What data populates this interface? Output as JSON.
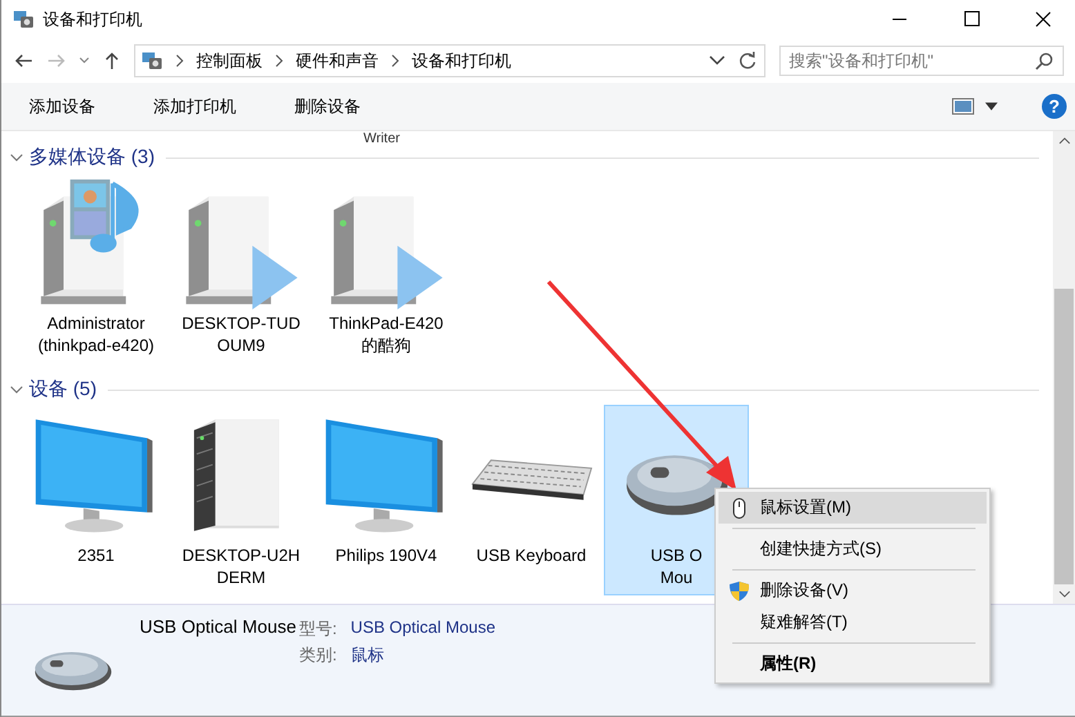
{
  "window": {
    "title": "设备和打印机"
  },
  "address": {
    "crumbs": [
      "控制面板",
      "硬件和声音",
      "设备和打印机"
    ]
  },
  "search": {
    "placeholder": "搜索\"设备和打印机\""
  },
  "toolbar": {
    "buttons": [
      "添加设备",
      "添加打印机",
      "删除设备"
    ],
    "help": "?"
  },
  "partial_label": "Writer",
  "groups": [
    {
      "title": "多媒体设备 (3)",
      "expanded": true,
      "items": [
        {
          "kind": "media-server",
          "lines": [
            "Administrator",
            "(thinkpad-e420)"
          ],
          "selected": false
        },
        {
          "kind": "stream-server",
          "lines": [
            "DESKTOP-TUD",
            "OUM9"
          ],
          "selected": false
        },
        {
          "kind": "stream-server",
          "lines": [
            "ThinkPad-E420",
            "的酷狗"
          ],
          "selected": false
        }
      ]
    },
    {
      "title": "设备 (5)",
      "expanded": true,
      "items": [
        {
          "kind": "monitor",
          "lines": [
            "2351"
          ],
          "selected": false
        },
        {
          "kind": "tower",
          "lines": [
            "DESKTOP-U2H",
            "DERM"
          ],
          "selected": false
        },
        {
          "kind": "monitor",
          "lines": [
            "Philips 190V4"
          ],
          "selected": false
        },
        {
          "kind": "keyboard",
          "lines": [
            "USB Keyboard"
          ],
          "selected": false
        },
        {
          "kind": "mouse",
          "lines": [
            "USB O",
            "Mou"
          ],
          "selected": true
        }
      ]
    }
  ],
  "details": {
    "name": "USB Optical Mouse",
    "fields": [
      {
        "label": "型号:",
        "value": "USB Optical Mouse"
      },
      {
        "label": "类别:",
        "value": "鼠标"
      }
    ]
  },
  "context_menu": [
    {
      "kind": "mouse",
      "label": "鼠标设置(M)",
      "selected": true,
      "default": false
    },
    {
      "kind": "separator"
    },
    {
      "kind": "plain",
      "label": "创建快捷方式(S)",
      "selected": false,
      "default": false
    },
    {
      "kind": "separator"
    },
    {
      "kind": "shield",
      "label": "删除设备(V)",
      "selected": false,
      "default": false
    },
    {
      "kind": "plain",
      "label": "疑难解答(T)",
      "selected": false,
      "default": false
    },
    {
      "kind": "separator"
    },
    {
      "kind": "plain",
      "label": "属性(R)",
      "selected": false,
      "default": true
    }
  ]
}
